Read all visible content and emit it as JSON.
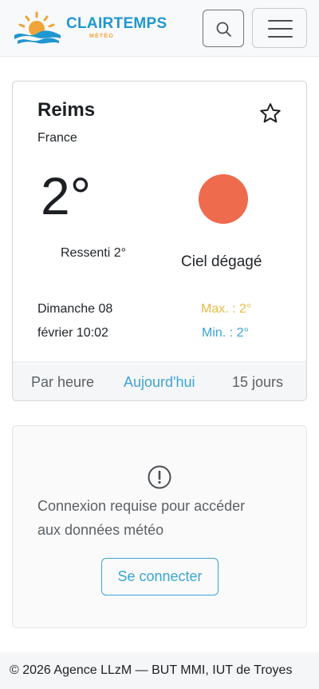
{
  "header": {
    "brand_name": "CLAIRTEMPS",
    "brand_tagline": "MÉTÉO",
    "search_icon": "search-icon",
    "menu_icon": "hamburger-menu-icon"
  },
  "weather": {
    "city": "Reims",
    "country": "France",
    "favorite_icon": "star-outline-icon",
    "temperature": "2°",
    "feels_like": "Ressenti 2°",
    "condition": "Ciel dégagé",
    "condition_icon": "sun-icon",
    "date_line1": "Dimanche 08",
    "date_line2": "février 10:02",
    "max": "Max. : 2°",
    "min": "Min. : 2°",
    "tabs": [
      {
        "label": "Par heure",
        "active": false
      },
      {
        "label": "Aujourd'hui",
        "active": true
      },
      {
        "label": "15 jours",
        "active": false
      }
    ]
  },
  "login_notice": {
    "icon": "exclamation-circle-icon",
    "message_line1": "Connexion requise pour accéder",
    "message_line2": "aux données météo",
    "button_label": "Se connecter"
  },
  "footer": {
    "text": "© 2026 Agence LLzM — BUT MMI, IUT de Troyes"
  },
  "colors": {
    "accent": "#3ba4d3",
    "max_temp": "#e9b949",
    "sun": "#ee6b4d",
    "brand_blue": "#1f97cf",
    "brand_orange": "#f0a53a"
  }
}
